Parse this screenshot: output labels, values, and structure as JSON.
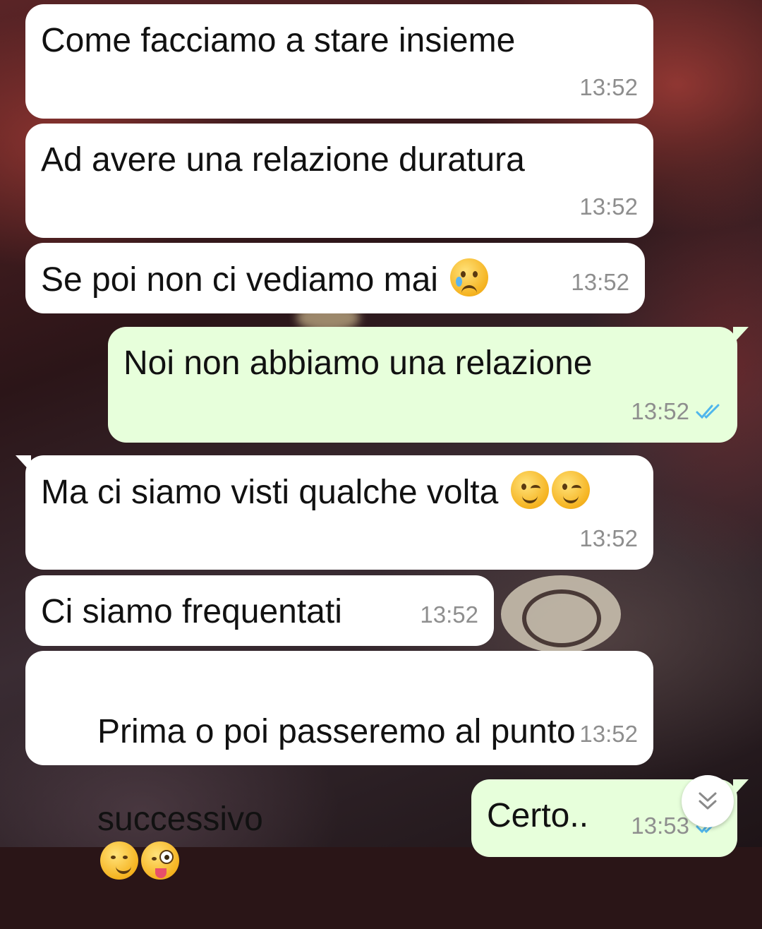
{
  "messages": [
    {
      "direction": "in",
      "text": "Come facciamo a stare insieme",
      "time": "13:52"
    },
    {
      "direction": "in",
      "text": "Ad avere una relazione duratura",
      "time": "13:52"
    },
    {
      "direction": "in",
      "text": "Se poi non ci vediamo mai",
      "emoji": [
        "crying-face"
      ],
      "time": "13:52"
    },
    {
      "direction": "out",
      "text": "Noi non abbiamo una relazione",
      "time": "13:52",
      "status": "read"
    },
    {
      "direction": "in",
      "text": "Ma ci siamo visti qualche volta",
      "emoji": [
        "winking-face",
        "winking-face"
      ],
      "time": "13:52"
    },
    {
      "direction": "in",
      "text": "Ci siamo frequentati",
      "time": "13:52"
    },
    {
      "direction": "in",
      "text_line1": "Prima o poi passeremo al punto",
      "text_line2": "successivo",
      "emoji": [
        "smirking-face",
        "winking-face-with-tongue"
      ],
      "time": "13:52"
    },
    {
      "direction": "out",
      "text": "Certo..",
      "time": "13:53",
      "status": "read"
    }
  ],
  "scroll_button": {
    "icon": "double-chevron-down-icon"
  },
  "colors": {
    "incoming_bubble": "#ffffff",
    "outgoing_bubble": "#e7ffdb",
    "read_ticks": "#4fb6ec",
    "timestamp": "#8e8e8e"
  }
}
